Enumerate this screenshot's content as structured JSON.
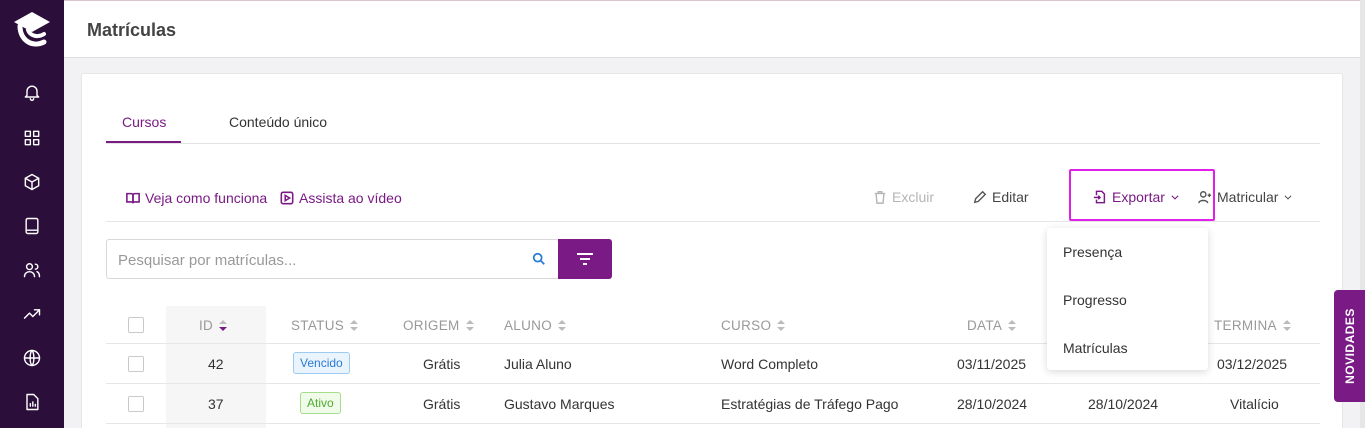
{
  "page": {
    "title": "Matrículas"
  },
  "tabs": [
    {
      "label": "Cursos",
      "active": true
    },
    {
      "label": "Conteúdo único",
      "active": false
    }
  ],
  "toolbar": {
    "how_it_works": "Veja como funciona",
    "watch_video": "Assista ao vídeo",
    "delete": "Excluir",
    "edit": "Editar",
    "export": "Exportar",
    "enroll": "Matricular"
  },
  "search": {
    "placeholder": "Pesquisar por matrículas..."
  },
  "table": {
    "headers": {
      "id": "ID",
      "status": "STATUS",
      "origin": "ORIGEM",
      "student": "ALUNO",
      "course": "CURSO",
      "date": "DATA",
      "ends": "TERMINA"
    },
    "rows": [
      {
        "id": "42",
        "status": "Vencido",
        "origin": "Grátis",
        "student": "Julia Aluno",
        "course": "Word Completo",
        "date": "03/11/2025",
        "start": "",
        "ends": "03/12/2025"
      },
      {
        "id": "37",
        "status": "Ativo",
        "origin": "Grátis",
        "student": "Gustavo Marques",
        "course": "Estratégias de Tráfego Pago",
        "date": "28/10/2024",
        "start": "28/10/2024",
        "ends": "Vitalício"
      }
    ]
  },
  "export_menu": {
    "items": [
      "Presença",
      "Progresso",
      "Matrículas"
    ]
  },
  "novidades": {
    "label": "NOVIDADES"
  },
  "sidebar": {
    "icons": [
      "notification-bell-icon",
      "dashboard-grid-icon",
      "product-box-icon",
      "book-icon",
      "users-icon",
      "trending-chart-icon",
      "globe-icon",
      "report-icon"
    ]
  },
  "colors": {
    "accent": "#7a1a85",
    "sidebar": "#2b0f3a",
    "highlight": "#e020e8",
    "status_blue": "#2a7ad6",
    "status_green": "#4cae2f"
  }
}
